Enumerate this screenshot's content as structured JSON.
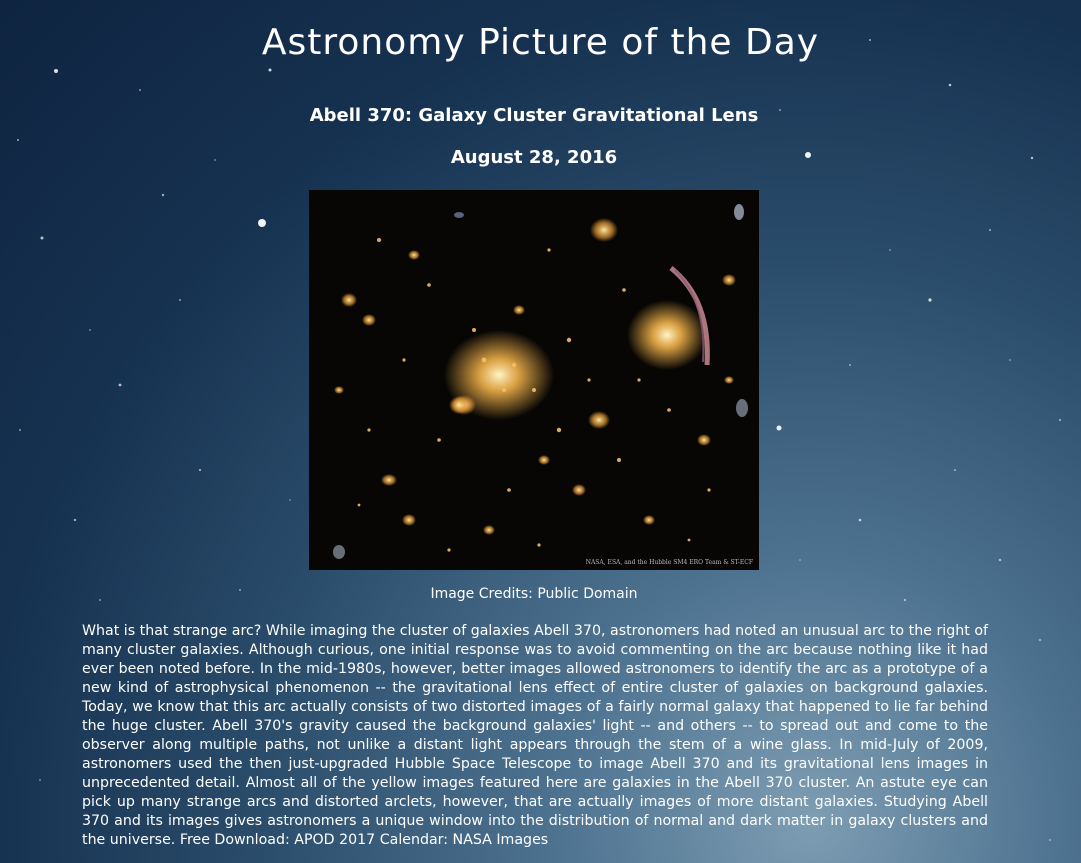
{
  "site": {
    "title": "Astronomy Picture of the Day"
  },
  "picture": {
    "title": "Abell 370: Galaxy Cluster Gravitational Lens",
    "date": "August 28, 2016",
    "image_watermark": "NASA, ESA, and the Hubble SM4 ERO Team & ST-ECF",
    "credits": "Image Credits: Public Domain",
    "explanation": "What is that strange arc? While imaging the cluster of galaxies Abell 370, astronomers had noted an unusual arc to the right of many cluster galaxies. Although curious, one initial response was to avoid commenting on the arc because nothing like it had ever been noted before. In the mid-1980s, however, better images allowed astronomers to identify the arc as a prototype of a new kind of astrophysical phenomenon -- the gravitational lens effect of entire cluster of galaxies on background galaxies. Today, we know that this arc actually consists of two distorted images of a fairly normal galaxy that happened to lie far behind the huge cluster. Abell 370's gravity caused the background galaxies' light -- and others -- to spread out and come to the observer along multiple paths, not unlike a distant light appears through the stem of a wine glass. In mid-July of 2009, astronomers used the then just-upgraded Hubble Space Telescope to image Abell 370 and its gravitational lens images in unprecedented detail. Almost all of the yellow images featured here are galaxies in the Abell 370 cluster. An astute eye can pick up many strange arcs and distorted arclets, however, that are actually images of more distant galaxies. Studying Abell 370 and its images gives astronomers a unique window into the distribution of normal and dark matter in galaxy clusters and the universe. Free Download: APOD 2017 Calendar: NASA Images"
  },
  "colors": {
    "background_top": "#0e2440",
    "background_glow": "#7d9db2",
    "text": "#ffffff",
    "galaxy": "#f2b24a"
  }
}
